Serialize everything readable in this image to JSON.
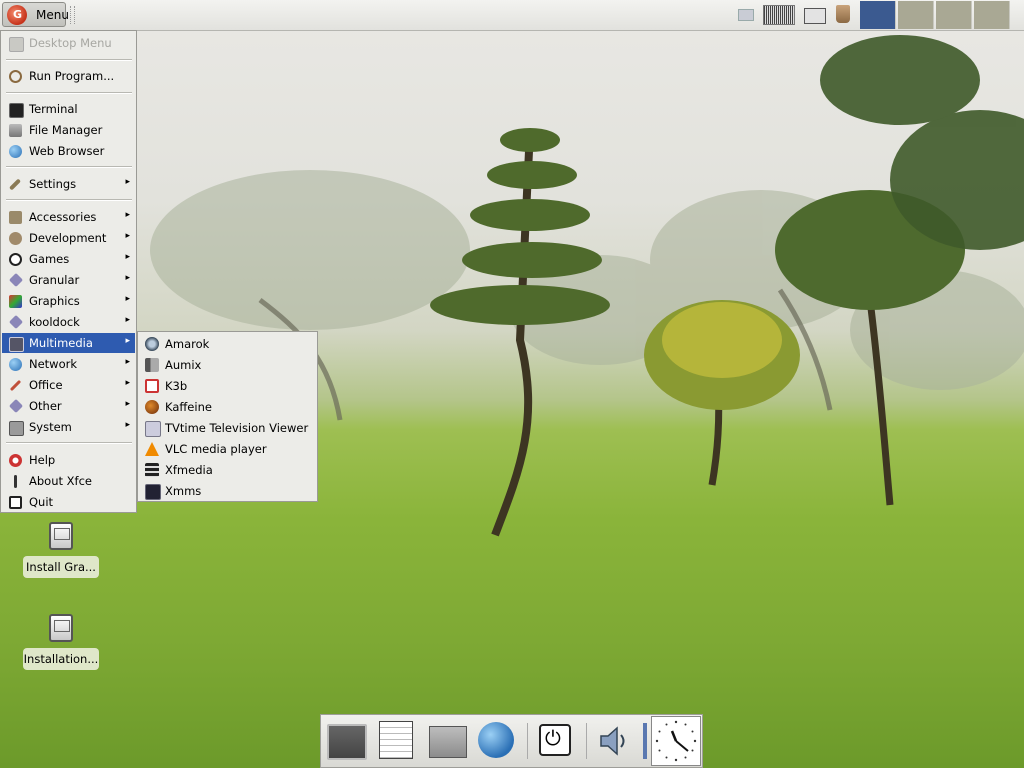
{
  "top_panel": {
    "menu_button_label": "Menu",
    "tray_icons": [
      "display-icon",
      "keyboard-layout-icon",
      "monitor-icon",
      "trash-icon"
    ],
    "workspaces": [
      {
        "active": true
      },
      {
        "active": false
      },
      {
        "active": false
      },
      {
        "active": false
      }
    ],
    "workspace_active_color": "#3b5a90",
    "workspace_inactive_color": "#a9a894"
  },
  "main_menu": {
    "items": [
      {
        "label": "Desktop Menu",
        "icon": "desktop-menu-icon",
        "disabled": true
      },
      {
        "label": "Run Program...",
        "icon": "gear-icon"
      },
      {
        "label": "Terminal",
        "icon": "terminal-icon"
      },
      {
        "label": "File Manager",
        "icon": "folder-icon"
      },
      {
        "label": "Web Browser",
        "icon": "globe-icon"
      },
      {
        "label": "Settings",
        "icon": "wrench-icon",
        "submenu": true
      },
      {
        "label": "Accessories",
        "icon": "tools-icon",
        "submenu": true
      },
      {
        "label": "Development",
        "icon": "gear-icon",
        "submenu": true
      },
      {
        "label": "Games",
        "icon": "ball-icon",
        "submenu": true
      },
      {
        "label": "Granular",
        "icon": "diamond-icon",
        "submenu": true
      },
      {
        "label": "Graphics",
        "icon": "paint-icon",
        "submenu": true
      },
      {
        "label": "kooldock",
        "icon": "diamond-icon",
        "submenu": true
      },
      {
        "label": "Multimedia",
        "icon": "multimedia-icon",
        "submenu": true,
        "active": true
      },
      {
        "label": "Network",
        "icon": "globe-icon",
        "submenu": true
      },
      {
        "label": "Office",
        "icon": "pen-icon",
        "submenu": true
      },
      {
        "label": "Other",
        "icon": "diamond-icon",
        "submenu": true
      },
      {
        "label": "System",
        "icon": "computer-icon",
        "submenu": true
      },
      {
        "label": "Help",
        "icon": "help-icon"
      },
      {
        "label": "About Xfce",
        "icon": "info-icon"
      },
      {
        "label": "Quit",
        "icon": "power-icon"
      }
    ],
    "submenu_arrow": "▸"
  },
  "multimedia_submenu": {
    "items": [
      {
        "label": "Amarok",
        "icon": "amarok-icon"
      },
      {
        "label": "Aumix",
        "icon": "speaker-icon"
      },
      {
        "label": "K3b",
        "icon": "k3b-icon"
      },
      {
        "label": "Kaffeine",
        "icon": "kaffeine-icon"
      },
      {
        "label": "TVtime Television Viewer",
        "icon": "tv-icon"
      },
      {
        "label": "VLC media player",
        "icon": "vlc-cone-icon"
      },
      {
        "label": "Xfmedia",
        "icon": "film-icon"
      },
      {
        "label": "Xmms",
        "icon": "xmms-icon"
      }
    ]
  },
  "desktop_icons": [
    {
      "label": "Install Gra..."
    },
    {
      "label": "Installation..."
    }
  ],
  "dock": {
    "items": [
      "desktop-icon",
      "notepad-icon",
      "file-cabinet-icon",
      "web-globe-icon",
      "power-icon",
      "volume-icon",
      "clock-icon"
    ]
  },
  "colors": {
    "menu_highlight": "#2e5bb0",
    "menu_background": "#ecece8"
  }
}
